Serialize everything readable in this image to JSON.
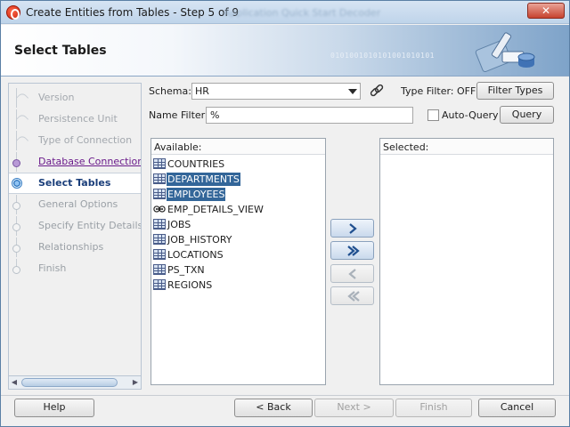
{
  "window": {
    "title": "Create Entities from Tables - Step 5 of 9",
    "title_suffix_blurred": "Application Quick Start Decoder",
    "close_glyph": "✕"
  },
  "banner": {
    "title": "Select Tables",
    "binary_text": "0101001010101001010101"
  },
  "steps": [
    {
      "label": "Version",
      "state": "visited"
    },
    {
      "label": "Persistence Unit",
      "state": "visited"
    },
    {
      "label": "Type of Connection",
      "state": "visited"
    },
    {
      "label": "Database Connection De",
      "state": "link"
    },
    {
      "label": "Select Tables",
      "state": "active"
    },
    {
      "label": "General Options",
      "state": "pending"
    },
    {
      "label": "Specify Entity Details",
      "state": "pending"
    },
    {
      "label": "Relationships",
      "state": "pending"
    },
    {
      "label": "Finish",
      "state": "pending"
    }
  ],
  "form": {
    "schema_label": "Schema:",
    "schema_value": "HR",
    "type_filter_label": "Type Filter: OFF",
    "filter_types_button": "Filter Types",
    "name_filter_label": "Name Filter:",
    "name_filter_value": "%",
    "auto_query_label": "Auto-Query",
    "auto_query_checked": false,
    "query_button": "Query"
  },
  "available": {
    "header": "Available:",
    "items": [
      {
        "name": "COUNTRIES",
        "icon": "table-icon",
        "selected": false
      },
      {
        "name": "DEPARTMENTS",
        "icon": "table-icon",
        "selected": true
      },
      {
        "name": "EMPLOYEES",
        "icon": "table-icon",
        "selected": true
      },
      {
        "name": "EMP_DETAILS_VIEW",
        "icon": "view-icon",
        "selected": false
      },
      {
        "name": "JOBS",
        "icon": "table-icon",
        "selected": false
      },
      {
        "name": "JOB_HISTORY",
        "icon": "table-icon",
        "selected": false
      },
      {
        "name": "LOCATIONS",
        "icon": "table-icon",
        "selected": false
      },
      {
        "name": "PS_TXN",
        "icon": "table-icon",
        "selected": false
      },
      {
        "name": "REGIONS",
        "icon": "table-icon",
        "selected": false
      }
    ]
  },
  "selected": {
    "header": "Selected:",
    "items": []
  },
  "shuttle": [
    {
      "name": "move-right-button",
      "icon": "chevron-right-icon",
      "enabled": true
    },
    {
      "name": "move-all-right-button",
      "icon": "double-chevron-right-icon",
      "enabled": true
    },
    {
      "name": "move-left-button",
      "icon": "chevron-left-icon",
      "enabled": false
    },
    {
      "name": "move-all-left-button",
      "icon": "double-chevron-left-icon",
      "enabled": false
    }
  ],
  "footer": {
    "help": "Help",
    "back": "< Back",
    "next": "Next >",
    "finish": "Finish",
    "cancel": "Cancel"
  },
  "colors": {
    "selection": "#336699",
    "link": "#6a1a8a",
    "active_step": "#1a3e7a"
  }
}
